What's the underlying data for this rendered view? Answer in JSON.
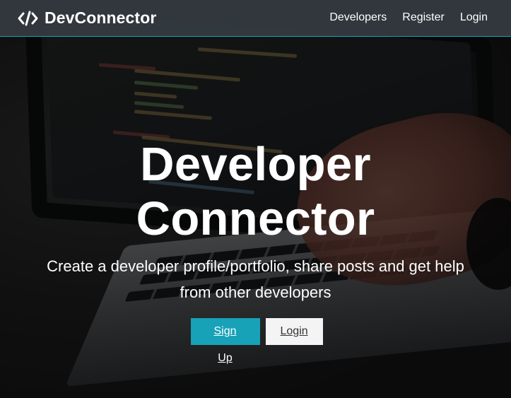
{
  "navbar": {
    "brand_icon": "code-icon",
    "brand_label": "DevConnector",
    "links": [
      {
        "label": "Developers"
      },
      {
        "label": "Register"
      },
      {
        "label": "Login"
      }
    ]
  },
  "hero": {
    "title_line1": "Developer",
    "title_line2": "Connector",
    "lead": "Create a developer profile/portfolio, share posts and get help from other developers",
    "buttons": {
      "signup_label": "Sign Up",
      "login_label": "Login"
    }
  },
  "colors": {
    "primary": "#17a2b8",
    "navbar": "#343a40",
    "light": "#f4f4f4"
  }
}
